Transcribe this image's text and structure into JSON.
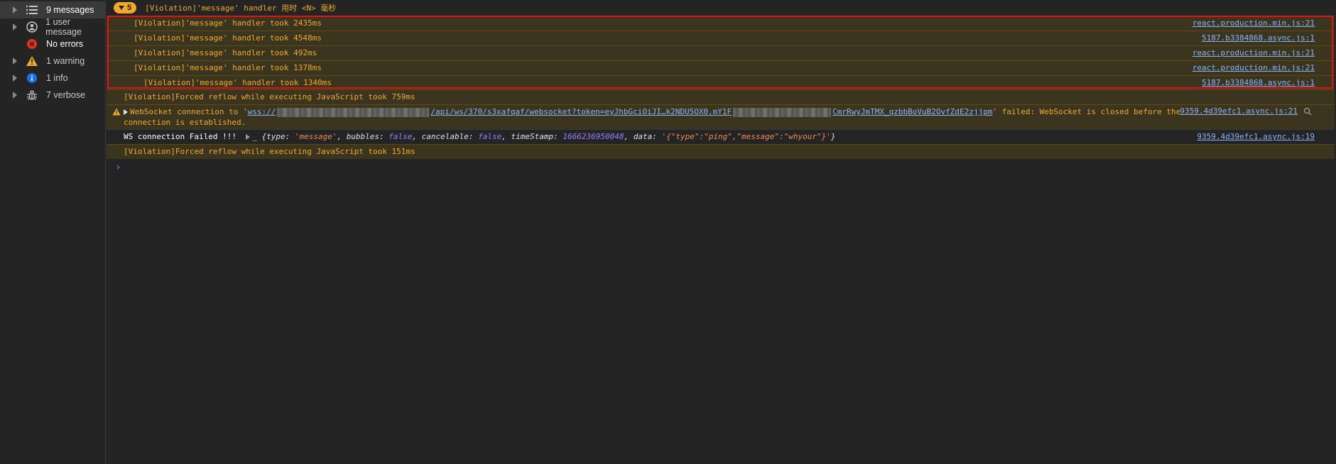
{
  "sidebar": {
    "items": [
      {
        "label": "9 messages",
        "icon": "list-icon"
      },
      {
        "label": "1 user message",
        "icon": "user-icon"
      },
      {
        "label": "No errors",
        "icon": "error-icon"
      },
      {
        "label": "1 warning",
        "icon": "warning-icon"
      },
      {
        "label": "1 info",
        "icon": "info-icon"
      },
      {
        "label": "7 verbose",
        "icon": "bug-icon"
      }
    ]
  },
  "group": {
    "count": "5",
    "title": "[Violation]'message' handler 用时 <N> 毫秒",
    "rows": [
      {
        "message": "[Violation]'message' handler took 2435ms",
        "source": "react.production.min.js:21"
      },
      {
        "message": "[Violation]'message' handler took 4548ms",
        "source": "5187.b3384868.async.js:1"
      },
      {
        "message": "[Violation]'message' handler took 492ms",
        "source": "react.production.min.js:21"
      },
      {
        "message": "[Violation]'message' handler took 1378ms",
        "source": "react.production.min.js:21"
      },
      {
        "message": "[Violation]'message' handler took 1340ms",
        "source": "5187.b3384868.async.js:1"
      }
    ]
  },
  "reflow1": {
    "message": "[Violation]Forced reflow while executing JavaScript took 759ms"
  },
  "websocket_warning": {
    "prefix": "WebSocket connection to '",
    "url_start": "wss://",
    "url_mid": "/api/ws/370/s3xafqaf/websocket?token=eyJhbGciOiJI…k2NDU5OX0.mY1F",
    "url_end": "CmrRwyJmTMX_qzbbBoVuB2OvfZdE2zjjpm",
    "suffix": "' failed: WebSocket is closed before the",
    "line2": "connection is established.",
    "source": "9359.4d39efc1.async.js:21"
  },
  "ws_failed": {
    "text": "WS connection Failed !!! ",
    "underscore": "_ {",
    "k_type": "type",
    "v_type": "'message'",
    "k_bubbles": "bubbles",
    "v_bubbles": "false",
    "k_cancelable": "cancelable",
    "v_cancelable": "false",
    "k_timestamp": "timeStamp",
    "v_timestamp": "1666236950048",
    "k_data": "data",
    "v_data": "'{\"type\":\"ping\",\"message\":\"whyour\"}'",
    "close": "}",
    "source": "9359.4d39efc1.async.js:19"
  },
  "reflow2": {
    "message": "[Violation]Forced reflow while executing JavaScript took 151ms"
  },
  "prompt": "›",
  "colors": {
    "warning": "#f0a830",
    "link": "#8ab4f8",
    "highlight": "#e01414",
    "background": "#242424"
  }
}
